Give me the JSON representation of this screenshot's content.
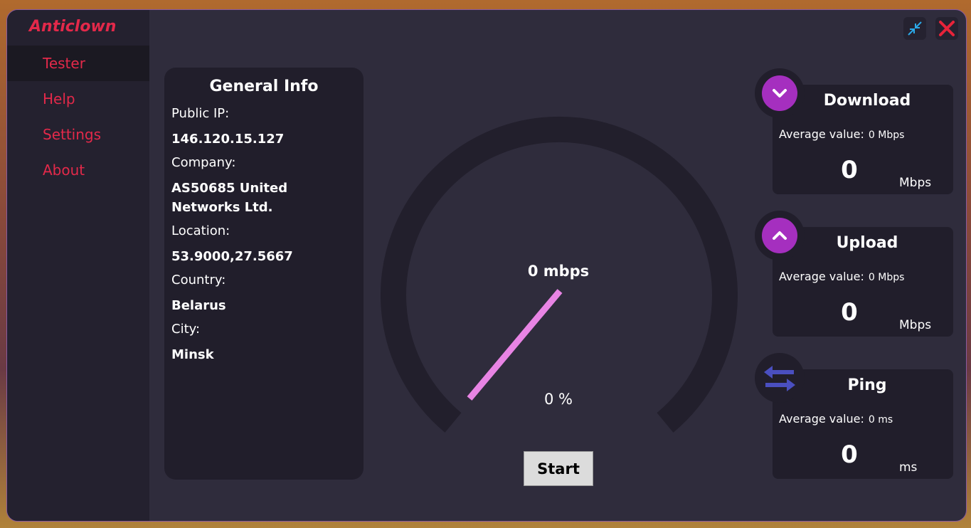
{
  "app": {
    "title": "Anticlown"
  },
  "nav": [
    {
      "label": "Tester",
      "active": true
    },
    {
      "label": "Help",
      "active": false
    },
    {
      "label": "Settings",
      "active": false
    },
    {
      "label": "About",
      "active": false
    }
  ],
  "window_controls": {
    "minimize_icon": "collapse-arrows-icon",
    "close_icon": "close-x-icon"
  },
  "general_info": {
    "title": "General Info",
    "public_ip_label": "Public IP:",
    "public_ip": "146.120.15.127",
    "company_label": "Company:",
    "company": "AS50685 United Networks Ltd.",
    "location_label": "Location:",
    "location": "53.9000,27.5667",
    "country_label": "Country:",
    "country": "Belarus",
    "city_label": "City:",
    "city": "Minsk"
  },
  "gauge": {
    "speed_text": "0 mbps",
    "percent_text": "0 %",
    "start_label": "Start",
    "needle_color": "#e884e4",
    "track_color": "#221f2c"
  },
  "download": {
    "title": "Download",
    "avg_label": "Average value:",
    "avg_value": "0 Mbps",
    "value": "0",
    "unit": "Mbps"
  },
  "upload": {
    "title": "Upload",
    "avg_label": "Average value:",
    "avg_value": "0 Mbps",
    "value": "0",
    "unit": "Mbps"
  },
  "ping": {
    "title": "Ping",
    "avg_label": "Average value:",
    "avg_value": "0 ms",
    "value": "0",
    "unit": "ms"
  },
  "colors": {
    "accent": "#e3294a",
    "badge": "#a52fbf",
    "ping_arrows": "#4a4fc0",
    "panel": "#211e2b",
    "window": "#2f2c3c"
  }
}
